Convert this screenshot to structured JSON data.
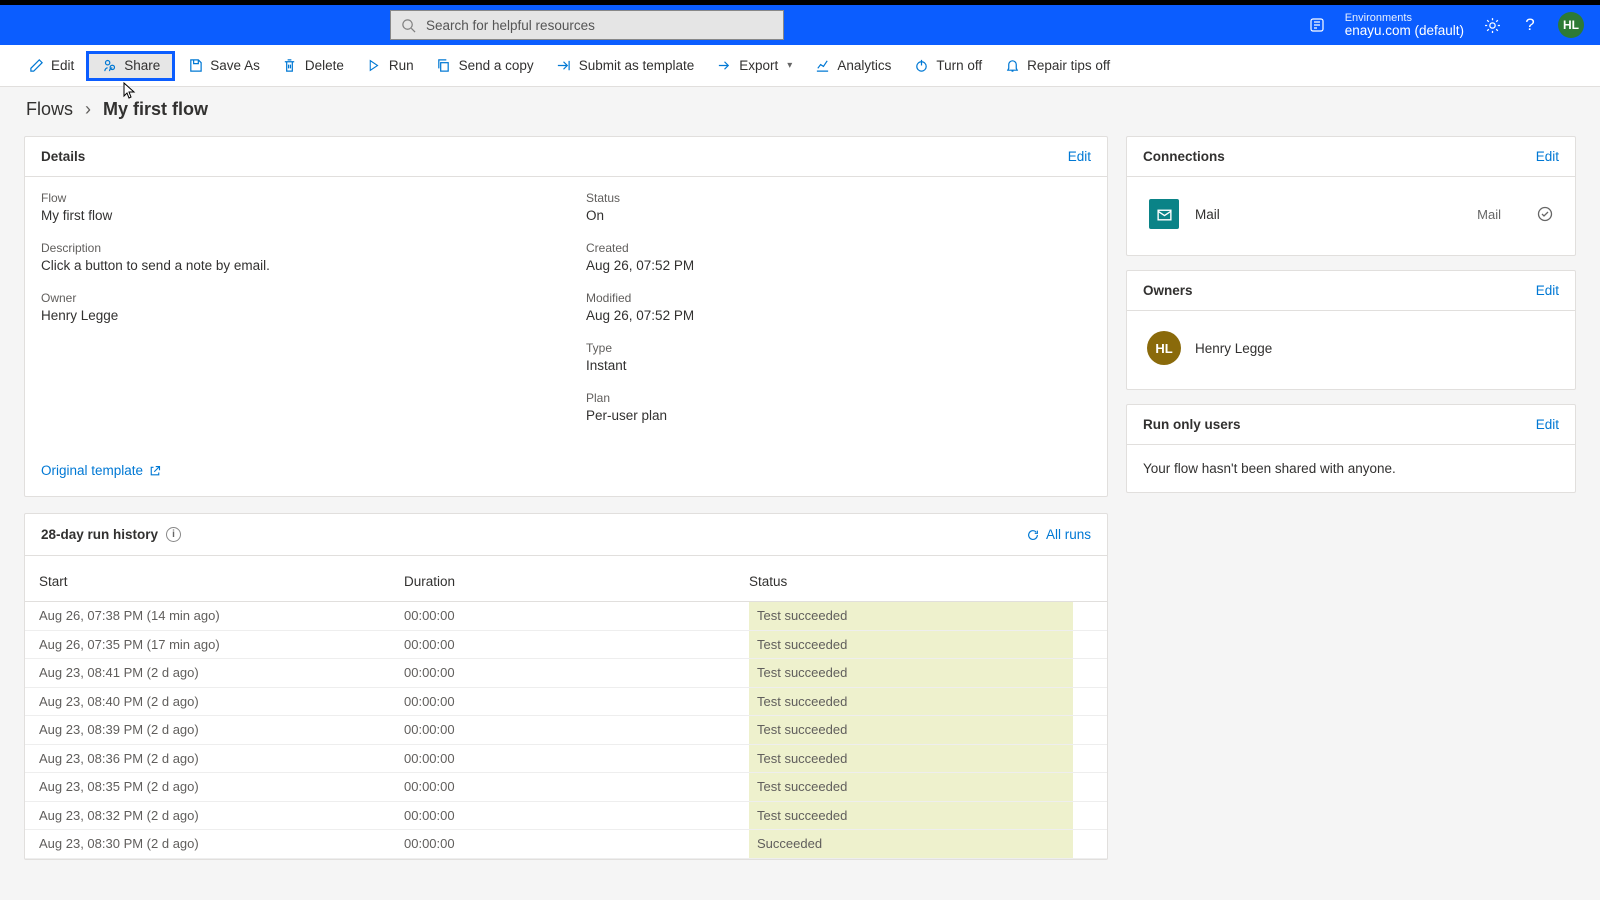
{
  "search_placeholder": "Search for helpful resources",
  "env_label": "Environments",
  "env_name": "enayu.com (default)",
  "avatar_initials": "HL",
  "commands": {
    "edit": "Edit",
    "share": "Share",
    "saveas": "Save As",
    "delete": "Delete",
    "run": "Run",
    "sendcopy": "Send a copy",
    "submit": "Submit as template",
    "export": "Export",
    "analytics": "Analytics",
    "turnoff": "Turn off",
    "repair": "Repair tips off"
  },
  "breadcrumb": {
    "root": "Flows",
    "current": "My first flow"
  },
  "details": {
    "title": "Details",
    "edit": "Edit",
    "flow_label": "Flow",
    "flow_value": "My first flow",
    "desc_label": "Description",
    "desc_value": "Click a button to send a note by email.",
    "owner_label": "Owner",
    "owner_value": "Henry Legge",
    "status_label": "Status",
    "status_value": "On",
    "created_label": "Created",
    "created_value": "Aug 26, 07:52 PM",
    "modified_label": "Modified",
    "modified_value": "Aug 26, 07:52 PM",
    "type_label": "Type",
    "type_value": "Instant",
    "plan_label": "Plan",
    "plan_value": "Per-user plan",
    "original_template": "Original template"
  },
  "history": {
    "title": "28-day run history",
    "all_runs": "All runs",
    "col_start": "Start",
    "col_duration": "Duration",
    "col_status": "Status",
    "rows": [
      {
        "start": "Aug 26, 07:38 PM (14 min ago)",
        "duration": "00:00:00",
        "status": "Test succeeded"
      },
      {
        "start": "Aug 26, 07:35 PM (17 min ago)",
        "duration": "00:00:00",
        "status": "Test succeeded"
      },
      {
        "start": "Aug 23, 08:41 PM (2 d ago)",
        "duration": "00:00:00",
        "status": "Test succeeded"
      },
      {
        "start": "Aug 23, 08:40 PM (2 d ago)",
        "duration": "00:00:00",
        "status": "Test succeeded"
      },
      {
        "start": "Aug 23, 08:39 PM (2 d ago)",
        "duration": "00:00:00",
        "status": "Test succeeded"
      },
      {
        "start": "Aug 23, 08:36 PM (2 d ago)",
        "duration": "00:00:00",
        "status": "Test succeeded"
      },
      {
        "start": "Aug 23, 08:35 PM (2 d ago)",
        "duration": "00:00:00",
        "status": "Test succeeded"
      },
      {
        "start": "Aug 23, 08:32 PM (2 d ago)",
        "duration": "00:00:00",
        "status": "Test succeeded"
      },
      {
        "start": "Aug 23, 08:30 PM (2 d ago)",
        "duration": "00:00:00",
        "status": "Succeeded"
      }
    ]
  },
  "connections": {
    "title": "Connections",
    "edit": "Edit",
    "item_name": "Mail",
    "item_sub": "Mail"
  },
  "owners": {
    "title": "Owners",
    "edit": "Edit",
    "initials": "HL",
    "name": "Henry Legge"
  },
  "runonly": {
    "title": "Run only users",
    "edit": "Edit",
    "message": "Your flow hasn't been shared with anyone."
  }
}
